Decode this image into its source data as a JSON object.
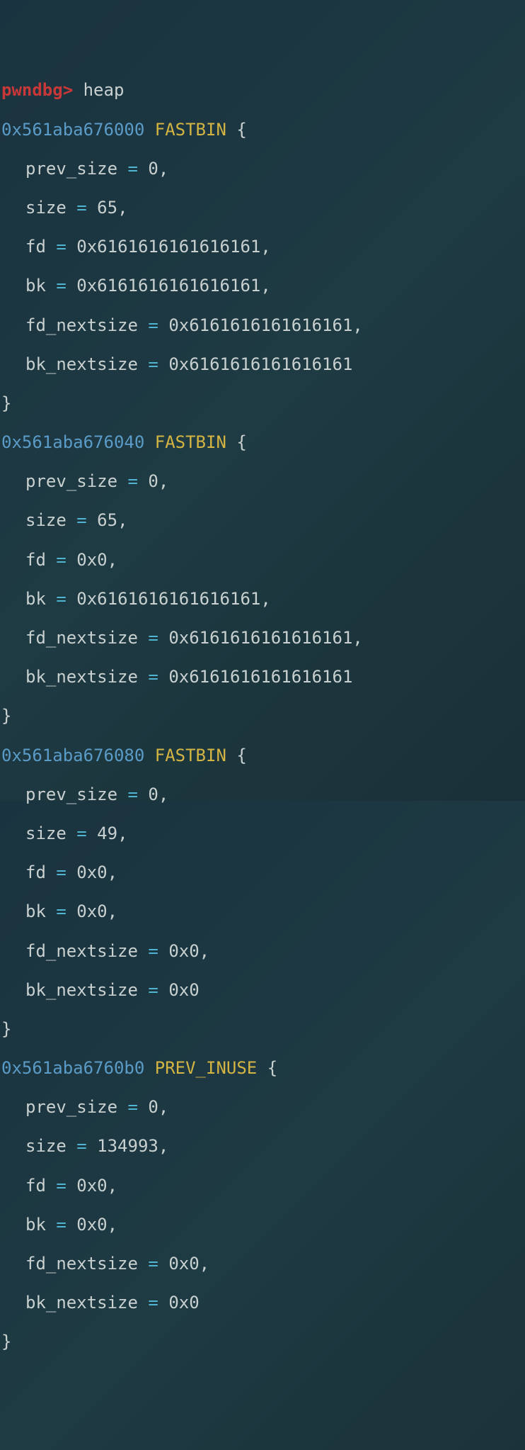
{
  "prompt": "pwndbg>",
  "command": "heap",
  "chunks": [
    {
      "addr": "0x561aba676000",
      "label": "FASTBIN",
      "prev_size": "0",
      "size": "65",
      "fd": "0x6161616161616161",
      "bk": "0x6161616161616161",
      "fd_nextsize": "0x6161616161616161",
      "bk_nextsize": "0x6161616161616161"
    },
    {
      "addr": "0x561aba676040",
      "label": "FASTBIN",
      "prev_size": "0",
      "size": "65",
      "fd": "0x0",
      "bk": "0x6161616161616161",
      "fd_nextsize": "0x6161616161616161",
      "bk_nextsize": "0x6161616161616161"
    },
    {
      "addr": "0x561aba676080",
      "label": "FASTBIN",
      "prev_size": "0",
      "size": "49",
      "fd": "0x0",
      "bk": "0x0",
      "fd_nextsize": "0x0",
      "bk_nextsize": "0x0"
    },
    {
      "addr": "0x561aba6760b0",
      "label": "PREV_INUSE",
      "prev_size": "0",
      "size": "134993",
      "fd": "0x0",
      "bk": "0x0",
      "fd_nextsize": "0x0",
      "bk_nextsize": "0x0"
    }
  ],
  "field_names": {
    "prev_size": "prev_size",
    "size": "size",
    "fd": "fd",
    "bk": "bk",
    "fd_nextsize": "fd_nextsize",
    "bk_nextsize": "bk_nextsize"
  },
  "symbols": {
    "eq": " = ",
    "open_brace": " {",
    "close_brace": "}",
    "comma": ","
  }
}
